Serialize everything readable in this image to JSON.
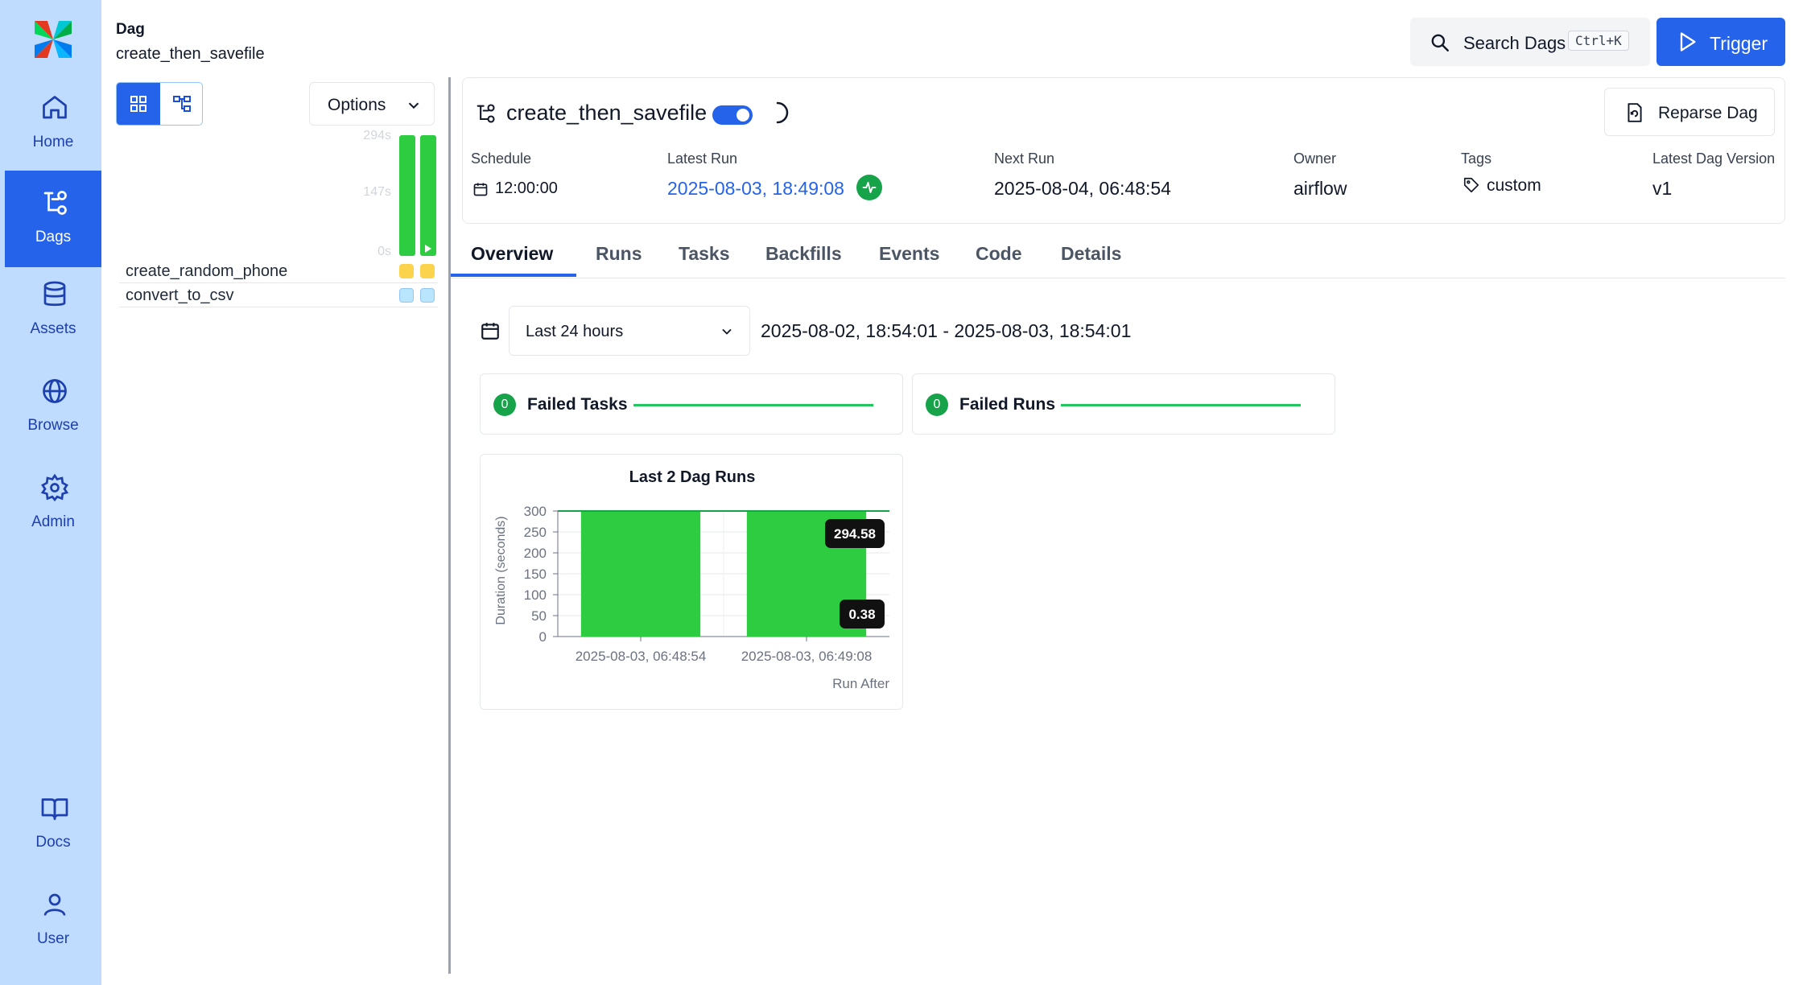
{
  "sidebar": {
    "items": [
      {
        "label": "Home",
        "icon": "home-icon",
        "active": false
      },
      {
        "label": "Dags",
        "icon": "dags-icon",
        "active": true
      },
      {
        "label": "Assets",
        "icon": "database-icon",
        "active": false
      },
      {
        "label": "Browse",
        "icon": "globe-icon",
        "active": false
      },
      {
        "label": "Admin",
        "icon": "gear-icon",
        "active": false
      },
      {
        "label": "Docs",
        "icon": "book-icon",
        "active": false
      },
      {
        "label": "User",
        "icon": "user-icon",
        "active": false
      }
    ]
  },
  "breadcrumb": {
    "label": "Dag",
    "name": "create_then_savefile"
  },
  "topbar": {
    "search_label": "Search Dags",
    "search_shortcut": "Ctrl+K",
    "trigger_label": "Trigger"
  },
  "grid_panel": {
    "options_label": "Options",
    "duration_ticks": [
      "294s",
      "147s",
      "0s"
    ],
    "tasks": [
      {
        "name": "create_random_phone",
        "states": [
          "upstream_failed",
          "upstream_failed"
        ]
      },
      {
        "name": "convert_to_csv",
        "states": [
          "none",
          "none"
        ]
      }
    ]
  },
  "dag": {
    "title": "create_then_savefile",
    "paused": false,
    "reparse_label": "Reparse Dag",
    "schedule_label": "Schedule",
    "schedule_value": "12:00:00",
    "latest_run_label": "Latest Run",
    "latest_run_value": "2025-08-03, 18:49:08",
    "next_run_label": "Next Run",
    "next_run_value": "2025-08-04, 06:48:54",
    "owner_label": "Owner",
    "owner_value": "airflow",
    "tags_label": "Tags",
    "tags_value": "custom",
    "version_label": "Latest Dag Version",
    "version_value": "v1"
  },
  "tabs": [
    "Overview",
    "Runs",
    "Tasks",
    "Backfills",
    "Events",
    "Code",
    "Details"
  ],
  "overview": {
    "range_select": "Last 24 hours",
    "range_text": "2025-08-02, 18:54:01 - 2025-08-03, 18:54:01",
    "failed_tasks": {
      "count": "0",
      "label": "Failed Tasks"
    },
    "failed_runs": {
      "count": "0",
      "label": "Failed Runs"
    }
  },
  "chart_data": {
    "type": "bar",
    "title": "Last 2 Dag Runs",
    "xlabel": "Run After",
    "ylabel": "Duration (seconds)",
    "ylim": [
      0,
      300
    ],
    "yticks": [
      0,
      50,
      100,
      150,
      200,
      250,
      300
    ],
    "categories": [
      "2025-08-03, 06:48:54",
      "2025-08-03, 06:49:08"
    ],
    "series": [
      {
        "values": [
          300,
          300
        ]
      }
    ],
    "annotations": [
      "294.58",
      "0.38"
    ],
    "color": "#2ecc40",
    "grid": true
  }
}
